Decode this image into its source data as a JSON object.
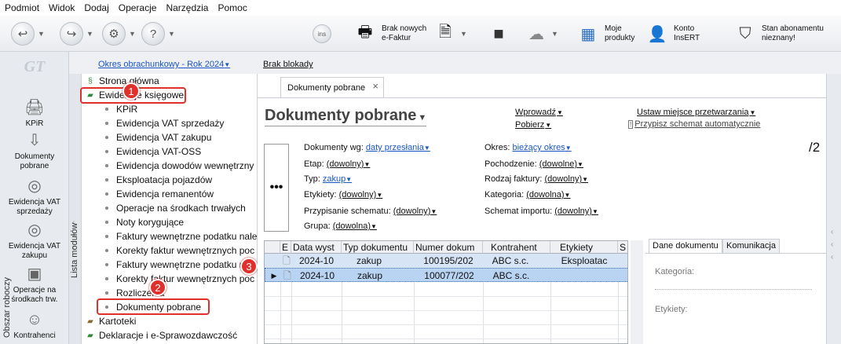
{
  "menu": [
    "Podmiot",
    "Widok",
    "Dodaj",
    "Operacje",
    "Narzędzia",
    "Pomoc"
  ],
  "toolbar": {
    "efaktur": "Brak nowych e-Faktur",
    "moje": "Moje produkty",
    "konto": "Konto InsERT",
    "stan": "Stan abonamentu nieznany!"
  },
  "logo": "GT",
  "side": [
    {
      "label": "KPiR",
      "icon": "printer-icon"
    },
    {
      "label": "Dokumenty pobrane",
      "icon": "download-icon"
    },
    {
      "label": "Ewidencja VAT sprzedaży",
      "icon": "coins-icon"
    },
    {
      "label": "Ewidencja VAT zakupu",
      "icon": "coins-icon"
    },
    {
      "label": "Operacje na środkach trw.",
      "icon": "machine-icon"
    },
    {
      "label": "Kontrahenci",
      "icon": "person-icon"
    }
  ],
  "modules_label": "Lista modułów",
  "topbar": {
    "period": "Okres obrachunkowy - Rok 2024",
    "lock": "Brak blokady"
  },
  "tree": {
    "strona": "Strona główna",
    "ewidencje": "Ewidencje księgowe",
    "children": [
      "KPiR",
      "Ewidencja VAT sprzedaży",
      "Ewidencja VAT zakupu",
      "Ewidencja VAT-OSS",
      "Ewidencja dowodów wewnętrzny",
      "Eksploatacja pojazdów",
      "Ewidencja remanentów",
      "Operacje na środkach trwałych",
      "Noty korygujące",
      "Faktury wewnętrzne podatku nale",
      "Korekty faktur wewnętrznych poc",
      "Faktury wewnętrzne podatku n",
      "Korekty faktur wewnętrznych poc",
      "Rozliczenia",
      "Dokumenty pobrane"
    ],
    "kartoteki": "Kartoteki",
    "deklaracje": "Deklaracje i e-Sprawozdawczość"
  },
  "badges": [
    "1",
    "2",
    "3"
  ],
  "tab": {
    "label": "Dokumenty pobrane"
  },
  "title": "Dokumenty pobrane",
  "links": {
    "wprowadz": "Wprowadź",
    "pobierz": "Pobierz",
    "ustaw": "Ustaw miejsce przetwarzania",
    "przypisz": "Przypisz schemat automatycznie"
  },
  "ellipsis": "•••",
  "filters": {
    "dokumenty_wg": {
      "label": "Dokumenty wg:",
      "value": "daty przesłania"
    },
    "etap": {
      "label": "Etap:",
      "value": "(dowolny)"
    },
    "typ": {
      "label": "Typ:",
      "value": "zakup"
    },
    "etykiety": {
      "label": "Etykiety:",
      "value": "(dowolny)"
    },
    "przypisanie": {
      "label": "Przypisanie schematu:",
      "value": "(dowolny)"
    },
    "grupa": {
      "label": "Grupa:",
      "value": "(dowolna)"
    },
    "okres": {
      "label": "Okres:",
      "value": "bieżący okres"
    },
    "pochodzenie": {
      "label": "Pochodzenie:",
      "value": "(dowolne)"
    },
    "rodzaj": {
      "label": "Rodzaj faktury:",
      "value": "(dowolny)"
    },
    "kategoria": {
      "label": "Kategoria:",
      "value": "(dowolna)"
    },
    "schemat": {
      "label": "Schemat importu:",
      "value": "(dowolny)"
    }
  },
  "counter": "/2",
  "grid": {
    "headers": [
      "E",
      "Data wyst",
      "Typ dokumentu",
      "Numer dokum",
      "Kontrahent",
      "Etykiety",
      "S"
    ],
    "rows": [
      {
        "date": "2024-10",
        "type": "zakup",
        "num": "100195/202",
        "kontr": "ABC s.c.",
        "etyk": "Eksploatac"
      },
      {
        "date": "2024-10",
        "type": "zakup",
        "num": "100077/202",
        "kontr": "ABC s.c.",
        "etyk": ""
      }
    ]
  },
  "rpanel": {
    "tab1": "Dane dokumentu",
    "tab2": "Komunikacja",
    "kategoria": "Kategoria:",
    "etykiety": "Etykiety:"
  },
  "obszar": "Obszar roboczy",
  "colors": {
    "accent": "#1a56c4",
    "highlight": "#e0302b",
    "selected": "#b9d3f2"
  }
}
